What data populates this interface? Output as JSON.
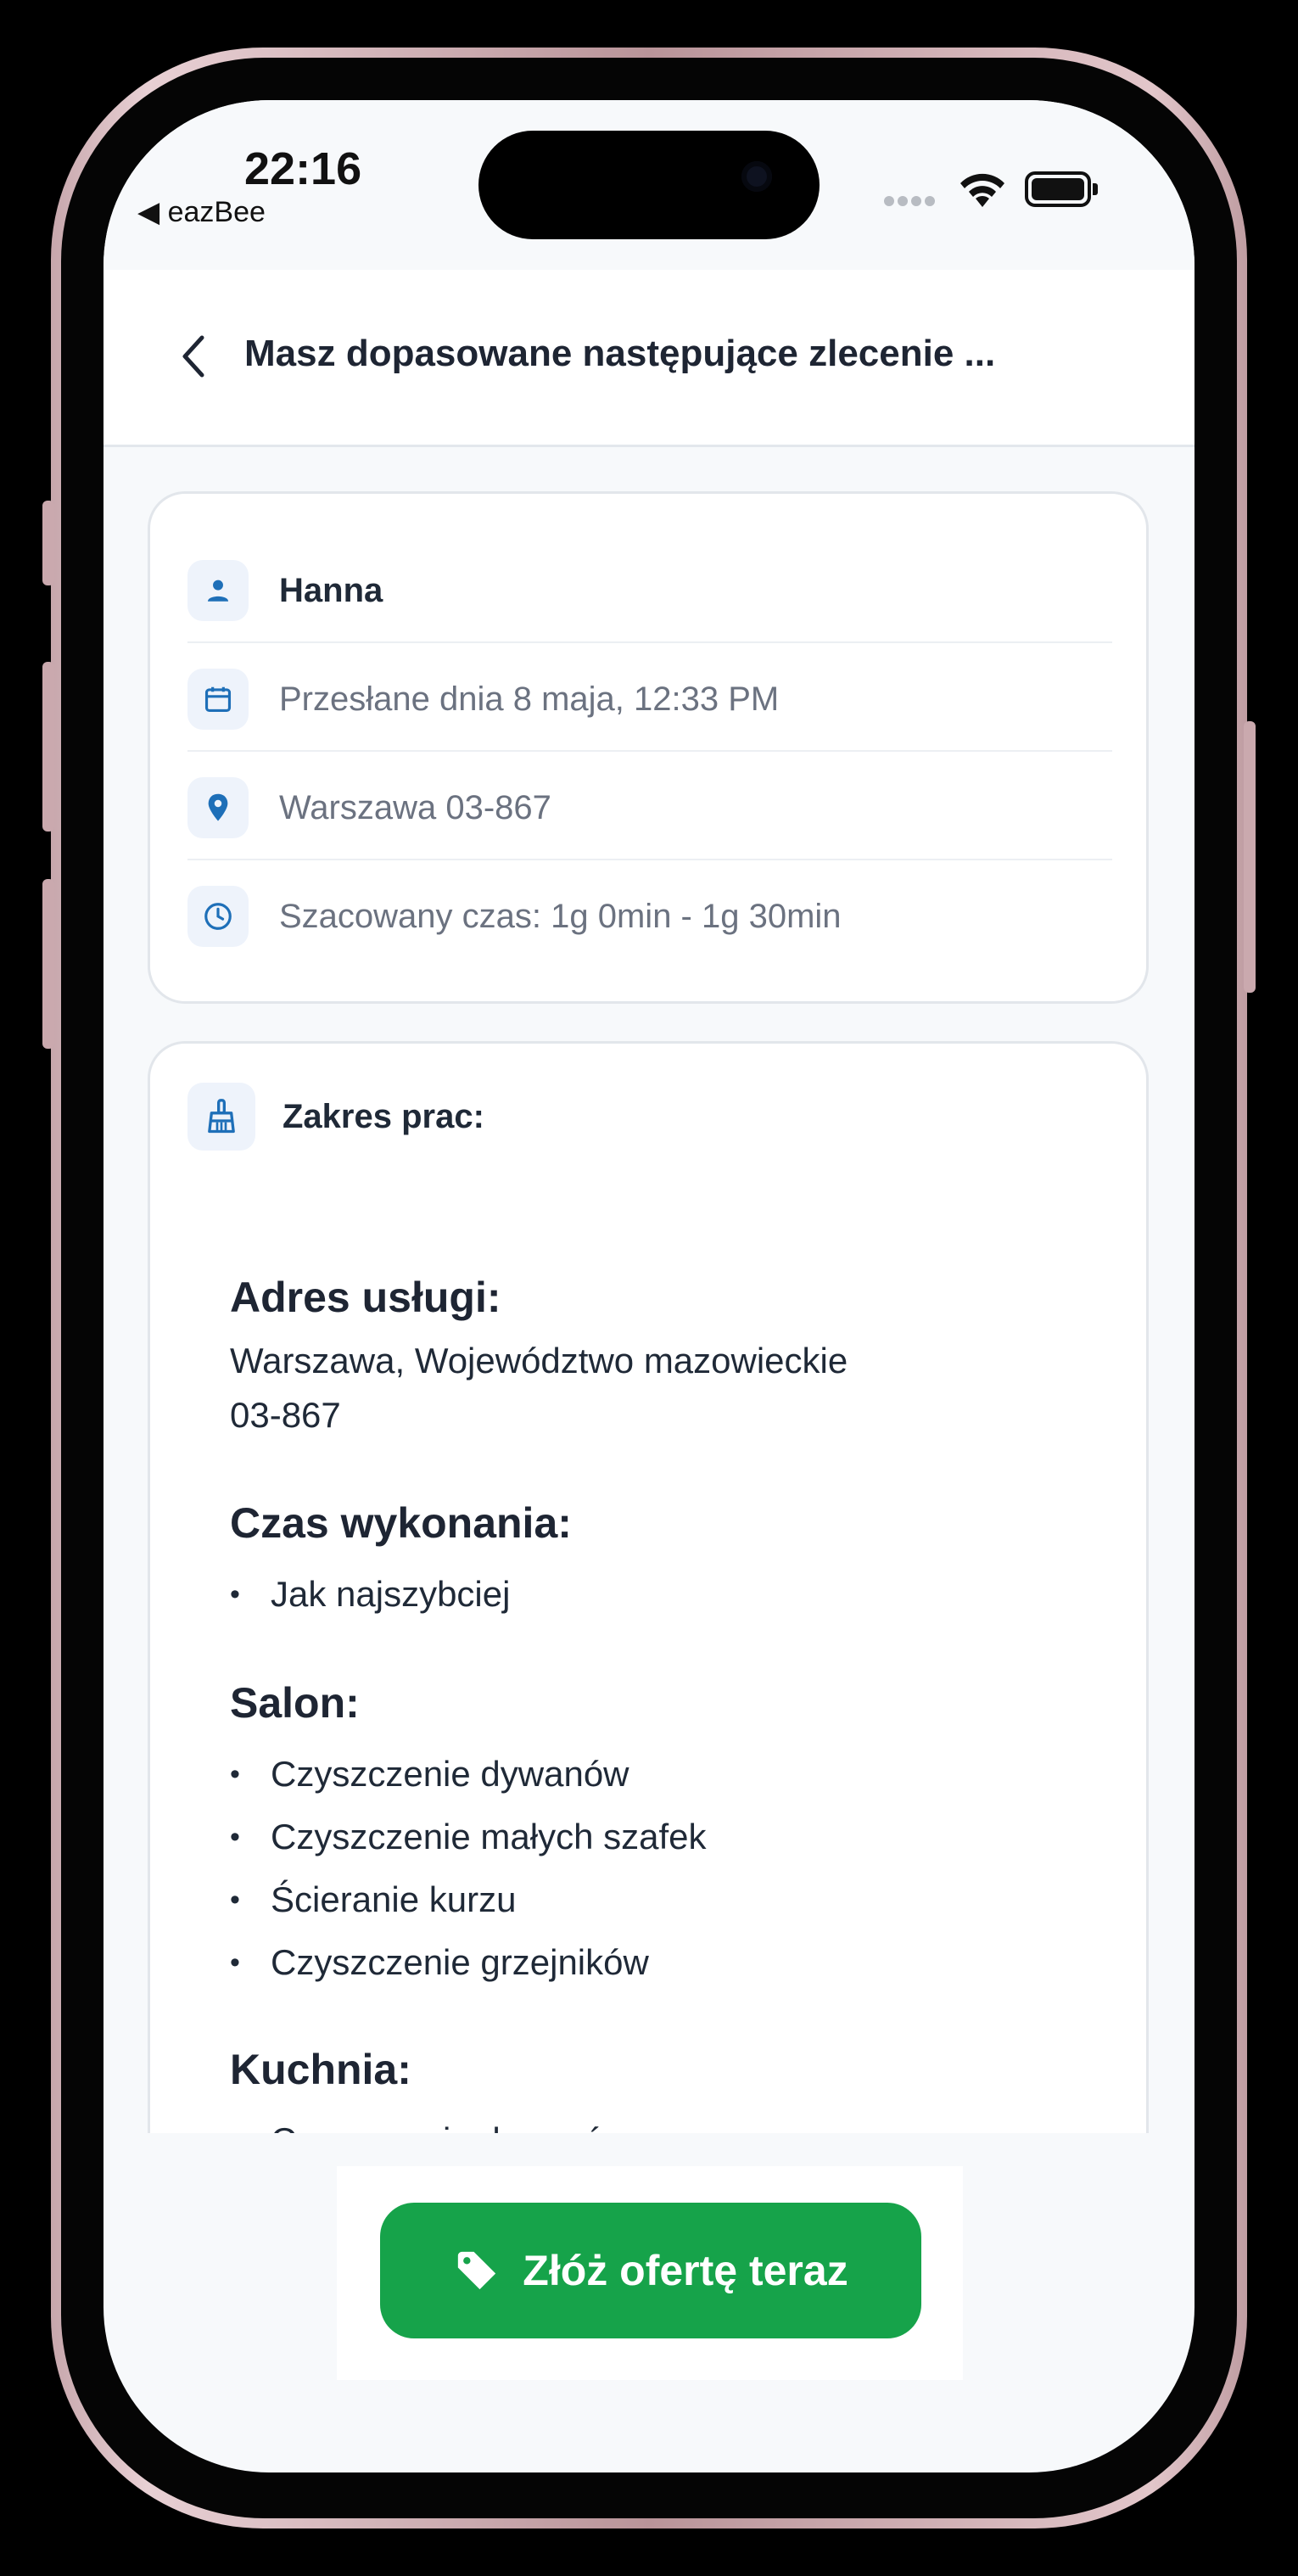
{
  "status_bar": {
    "time": "22:16",
    "back_app": "◀ eazBee"
  },
  "header": {
    "title": "Masz dopasowane następujące zlecenie ..."
  },
  "info": {
    "client_name": "Hanna",
    "sent_date": "Przesłane dnia 8 maja, 12:33 PM",
    "location": "Warszawa 03-867",
    "estimated_time": "Szacowany czas: 1g 0min - 1g 30min"
  },
  "scope": {
    "title": "Zakres prac:",
    "address_title": "Adres usługi:",
    "address_line1": "Warszawa, Województwo mazowieckie",
    "address_line2": "03-867",
    "time_title": "Czas wykonania:",
    "time_items": [
      "Jak najszybciej"
    ],
    "salon_title": "Salon:",
    "salon_items": [
      "Czyszczenie dywanów",
      "Czyszczenie małych szafek",
      "Ścieranie kurzu",
      "Czyszczenie grzejników"
    ],
    "kitchen_title": "Kuchnia:",
    "kitchen_items": [
      "Czyszczenie dywanów"
    ]
  },
  "actions": {
    "offer_label": "Złóż ofertę teraz"
  },
  "colors": {
    "accent": "#16a34a",
    "icon_blue": "#1e6fb8",
    "icon_bg": "#eef3fb"
  }
}
